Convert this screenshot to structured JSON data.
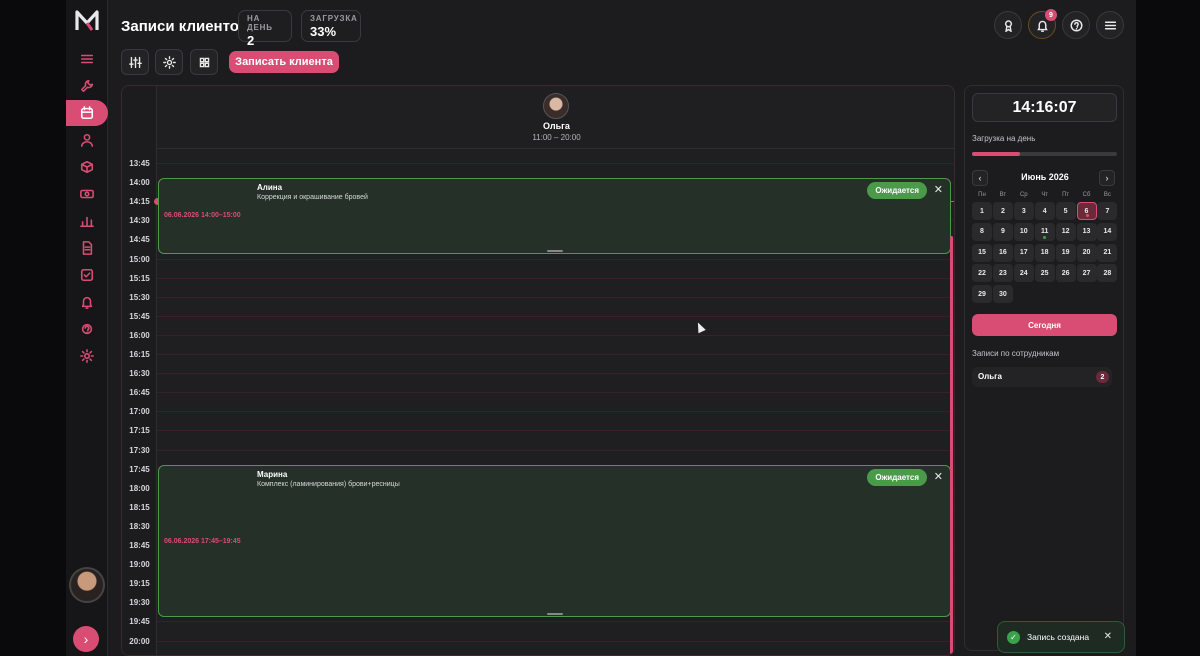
{
  "header": {
    "title": "Записи клиентов",
    "stats": [
      {
        "label": "НА ДЕНЬ",
        "value": "2"
      },
      {
        "label": "ЗАГРУЗКА",
        "value": "33%"
      }
    ],
    "notifications_count": "9"
  },
  "toolbar": {
    "record_label": "Записать клиента"
  },
  "staff": {
    "name": "Ольга",
    "hours": "11:00 – 20:00"
  },
  "time_slots": [
    "13:45",
    "14:00",
    "14:15",
    "14:30",
    "14:45",
    "15:00",
    "15:15",
    "15:30",
    "15:45",
    "16:00",
    "16:15",
    "16:30",
    "16:45",
    "17:00",
    "17:15",
    "17:30",
    "17:45",
    "18:00",
    "18:15",
    "18:30",
    "18:45",
    "19:00",
    "19:15",
    "19:30",
    "19:45",
    "20:00"
  ],
  "appointments": [
    {
      "client": "Алина",
      "service": "Коррекция и окрашивание бровей",
      "datetime": "06.06.2026 14:00–15:00",
      "status": "Ожидается"
    },
    {
      "client": "Марина",
      "service": "Комплекс (ламинирования) брови+ресницы",
      "datetime": "06.06.2026 17:45–19:45",
      "status": "Ожидается"
    }
  ],
  "panel": {
    "clock": "14:16:07",
    "load_label": "Загрузка на день",
    "load_fraction": 0.33,
    "month": "Июнь 2026",
    "prev": "‹",
    "next": "›",
    "weekdays": [
      "Пн",
      "Вт",
      "Ср",
      "Чт",
      "Пт",
      "Сб",
      "Вс"
    ],
    "days": [
      "1",
      "2",
      "3",
      "4",
      "5",
      "6",
      "7",
      "8",
      "9",
      "10",
      "11",
      "12",
      "13",
      "14",
      "15",
      "16",
      "17",
      "18",
      "19",
      "20",
      "21",
      "22",
      "23",
      "24",
      "25",
      "26",
      "27",
      "28",
      "29",
      "30"
    ],
    "selected_day": "6",
    "today_label": "Сегодня",
    "by_staff_label": "Записи по сотрудникам",
    "by_staff": [
      {
        "name": "Ольга",
        "count": "2"
      }
    ]
  },
  "toast": {
    "message": "Запись создана"
  },
  "colors": {
    "accent": "#d94d74",
    "success": "#4a9a4a",
    "background": "#1c1c1e"
  }
}
